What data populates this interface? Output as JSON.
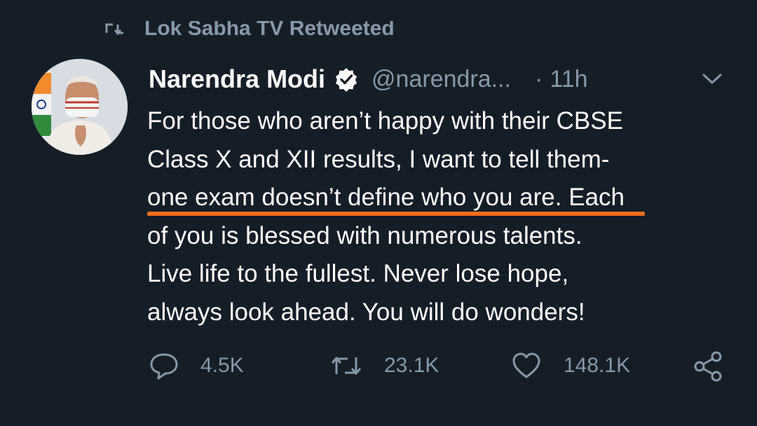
{
  "retweet_context": {
    "icon": "retweet-icon",
    "label": "Lok Sabha TV Retweeted"
  },
  "tweet": {
    "author_name": "Narendra Modi",
    "verified": true,
    "handle": "@narendra...",
    "separator": "·",
    "time": "11h",
    "text_lines": [
      "For those who aren’t happy with their CBSE",
      "Class X and XII results, I want to tell them-",
      "one exam doesn’t define who you are.",
      "of you is blessed with numerous talents.",
      "Live life to the fullest. Never lose hope,",
      "always look ahead. You will do wonders!"
    ],
    "line3_tail": " Each"
  },
  "actions": {
    "replies": "4.5K",
    "retweets": "23.1K",
    "likes": "148.1K"
  },
  "colors": {
    "background": "#151d27",
    "text": "#ffffff",
    "muted": "#8899a6",
    "underline": "#f26b1d"
  }
}
